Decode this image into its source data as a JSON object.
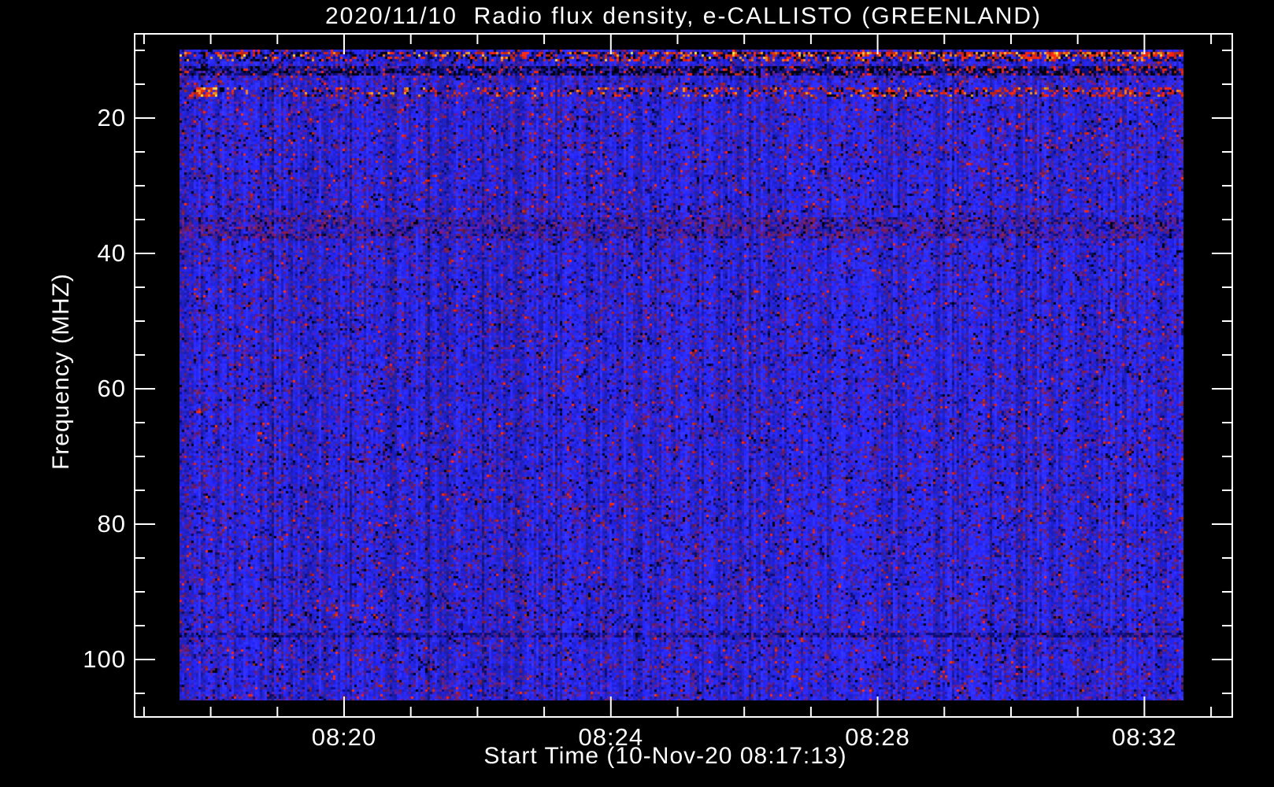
{
  "window": {
    "background": "#000000",
    "foreground": "#ffffff"
  },
  "chart_data": {
    "type": "heatmap",
    "subtype": "radio-spectrogram",
    "title": "2020/11/10  Radio flux density, e-CALLISTO (GREENLAND)",
    "xlabel": "Start Time (10-Nov-20 08:17:13)",
    "ylabel": "Frequency (MHZ)",
    "date": "2020/11/10",
    "instrument": "e-CALLISTO",
    "station": "GREENLAND",
    "start_time": "08:17:13",
    "legend": "none",
    "grid": "off",
    "x_axis": {
      "major_ticks": [
        {
          "minute": 20,
          "label": "08:20"
        },
        {
          "minute": 24,
          "label": "08:24"
        },
        {
          "minute": 28,
          "label": "08:28"
        },
        {
          "minute": 32,
          "label": "08:32"
        }
      ],
      "minor_tick_minutes": [
        17,
        18,
        19,
        21,
        22,
        23,
        25,
        26,
        27,
        29,
        30,
        31,
        33
      ],
      "minutes_per_minor_tick": 1,
      "data_start": "08:17:13",
      "data_end": "08:32:45"
    },
    "y_axis": {
      "major_ticks": [
        {
          "value": 20,
          "label": "20"
        },
        {
          "value": 40,
          "label": "40"
        },
        {
          "value": 60,
          "label": "60"
        },
        {
          "value": 80,
          "label": "80"
        },
        {
          "value": 100,
          "label": "100"
        }
      ],
      "minor_tick_values": [
        10,
        15,
        25,
        30,
        35,
        45,
        50,
        55,
        65,
        70,
        75,
        85,
        90,
        95,
        105
      ],
      "range_mhz": [
        9.9,
        106.3
      ],
      "inverted": true
    },
    "heatmap": {
      "description": "broadband blue noise continuum with sparse dark-purple speckles, scattered red RFI pixels, and horizontal RFI bands near the top of the frequency range",
      "palette": {
        "background_blue": "#2424d2",
        "speckle_purple": "#5a1e96",
        "speckle_maroon": "#7a1e50",
        "dark_navy": "#0d0d78",
        "rfi_red": "#dc2814",
        "rfi_orange": "#ff8c1e",
        "rfi_yellow": "#ffd24a",
        "black": "#000010"
      },
      "bands": [
        {
          "id": "rfi-top",
          "freq_mhz": [
            9.9,
            11.3
          ],
          "character": "dense red/orange/yellow RFI speckle band, intensifying toward later times"
        },
        {
          "id": "dark-band",
          "freq_mhz": [
            12.2,
            13.6
          ],
          "character": "dark band of black/navy pixels with red speckles on the right half"
        },
        {
          "id": "red-band",
          "freq_mhz": [
            15.4,
            16.8
          ],
          "character": "red RFI speckle band with a bright red-white burst near 08:17:50",
          "burst_minute": [
            17.78,
            18.08
          ]
        },
        {
          "id": "dark-35",
          "freq_mhz": [
            34.5,
            37.5
          ],
          "character": "slightly darker band with maroon/purple speckles"
        },
        {
          "id": "dark-96",
          "freq_mhz": [
            95.7,
            96.6
          ],
          "character": "faint thin dark horizontal line"
        }
      ]
    }
  }
}
